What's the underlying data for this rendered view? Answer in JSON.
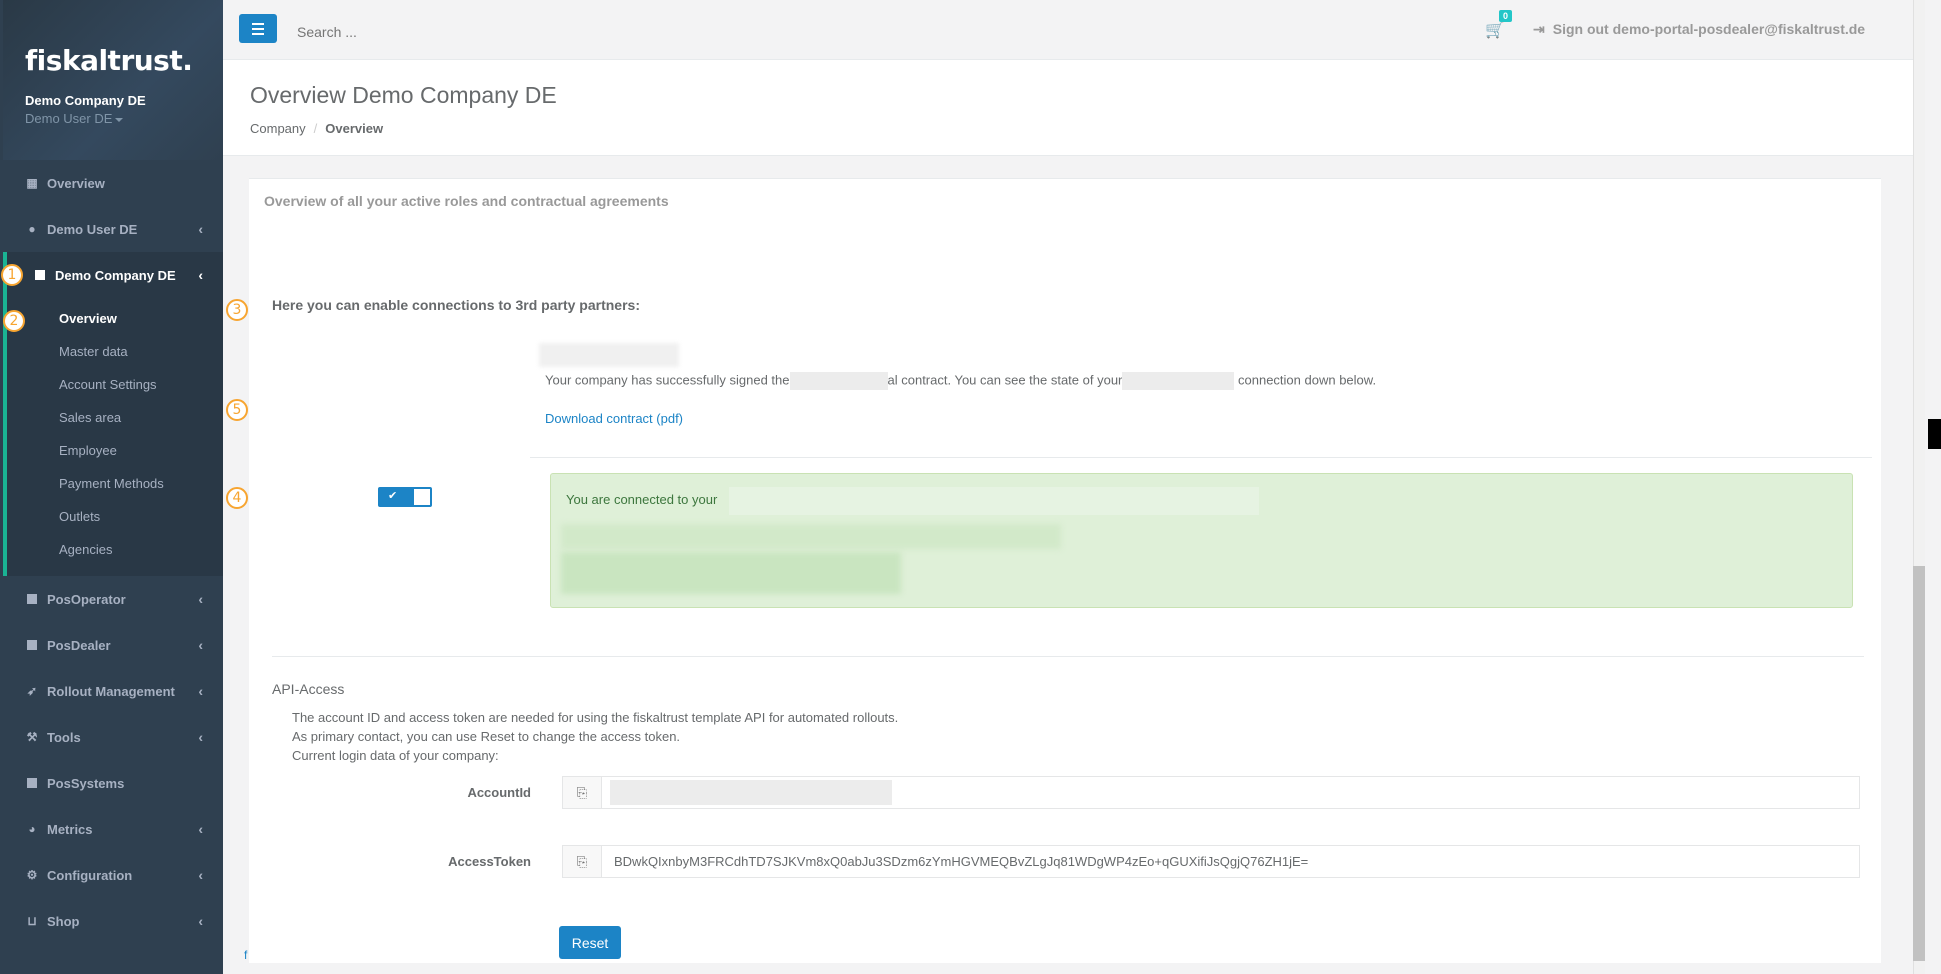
{
  "sidebar": {
    "logo": "fiskaltrust.",
    "company": "Demo Company DE",
    "user": "Demo User DE",
    "items": [
      {
        "label": "Overview",
        "icon": "th-large-icon"
      },
      {
        "label": "Demo User DE",
        "icon": "user-icon"
      },
      {
        "label": "Demo Company DE",
        "icon": "building-icon"
      },
      {
        "label": "PosOperator",
        "icon": "building-icon"
      },
      {
        "label": "PosDealer",
        "icon": "building-icon"
      },
      {
        "label": "Rollout Management",
        "icon": "rocket-icon"
      },
      {
        "label": "Tools",
        "icon": "wrench-icon"
      },
      {
        "label": "PosSystems",
        "icon": "briefcase-icon"
      },
      {
        "label": "Metrics",
        "icon": "pie-chart-icon"
      },
      {
        "label": "Configuration",
        "icon": "cogs-icon"
      },
      {
        "label": "Shop",
        "icon": "basket-icon"
      }
    ],
    "sub_items": [
      "Overview",
      "Master data",
      "Account Settings",
      "Sales area",
      "Employee",
      "Payment Methods",
      "Outlets",
      "Agencies"
    ]
  },
  "markers": [
    "1",
    "2",
    "3",
    "4",
    "5"
  ],
  "topbar": {
    "search_placeholder": "Search ...",
    "cart_count": "0",
    "signout": "Sign out demo-portal-posdealer@fiskaltrust.de"
  },
  "heading": {
    "title": "Overview Demo Company DE",
    "breadcrumb_1": "Company",
    "breadcrumb_sep": "/",
    "breadcrumb_2": "Overview"
  },
  "panel": {
    "title": "Overview of all your active roles and contractual agreements",
    "section_title": "Here you can enable connections to 3rd party partners:",
    "contract_part1": "Your company has successfully signed the",
    "contract_part2": "al contract. You can see the state of your",
    "contract_part3": "connection down below.",
    "download_link": "Download contract (pdf)",
    "alert_text": "You are connected to your",
    "toggle_checked": true
  },
  "api": {
    "title": "API-Access",
    "line1": "The account ID and access token are needed for using the fiskaltrust template API for automated rollouts.",
    "line2": "As primary contact, you can use Reset to change the access token.",
    "line3": "Current login data of your company:",
    "account_label": "AccountId",
    "token_label": "AccessToken",
    "token_value": "BDwkQIxnbyM3FRCdhTD7SJKVm8xQ0abJu3SDzm6zYmHGVMEQBvZLgJq81WDgWP4zEo+qGUXifiJsQgjQ76ZH1jE=",
    "reset_label": "Reset"
  },
  "footer": {
    "link": "f"
  },
  "colors": {
    "sidebar": "#2f4050",
    "accent": "#1c84c6",
    "green": "#1ab394",
    "marker": "#f7a531"
  }
}
